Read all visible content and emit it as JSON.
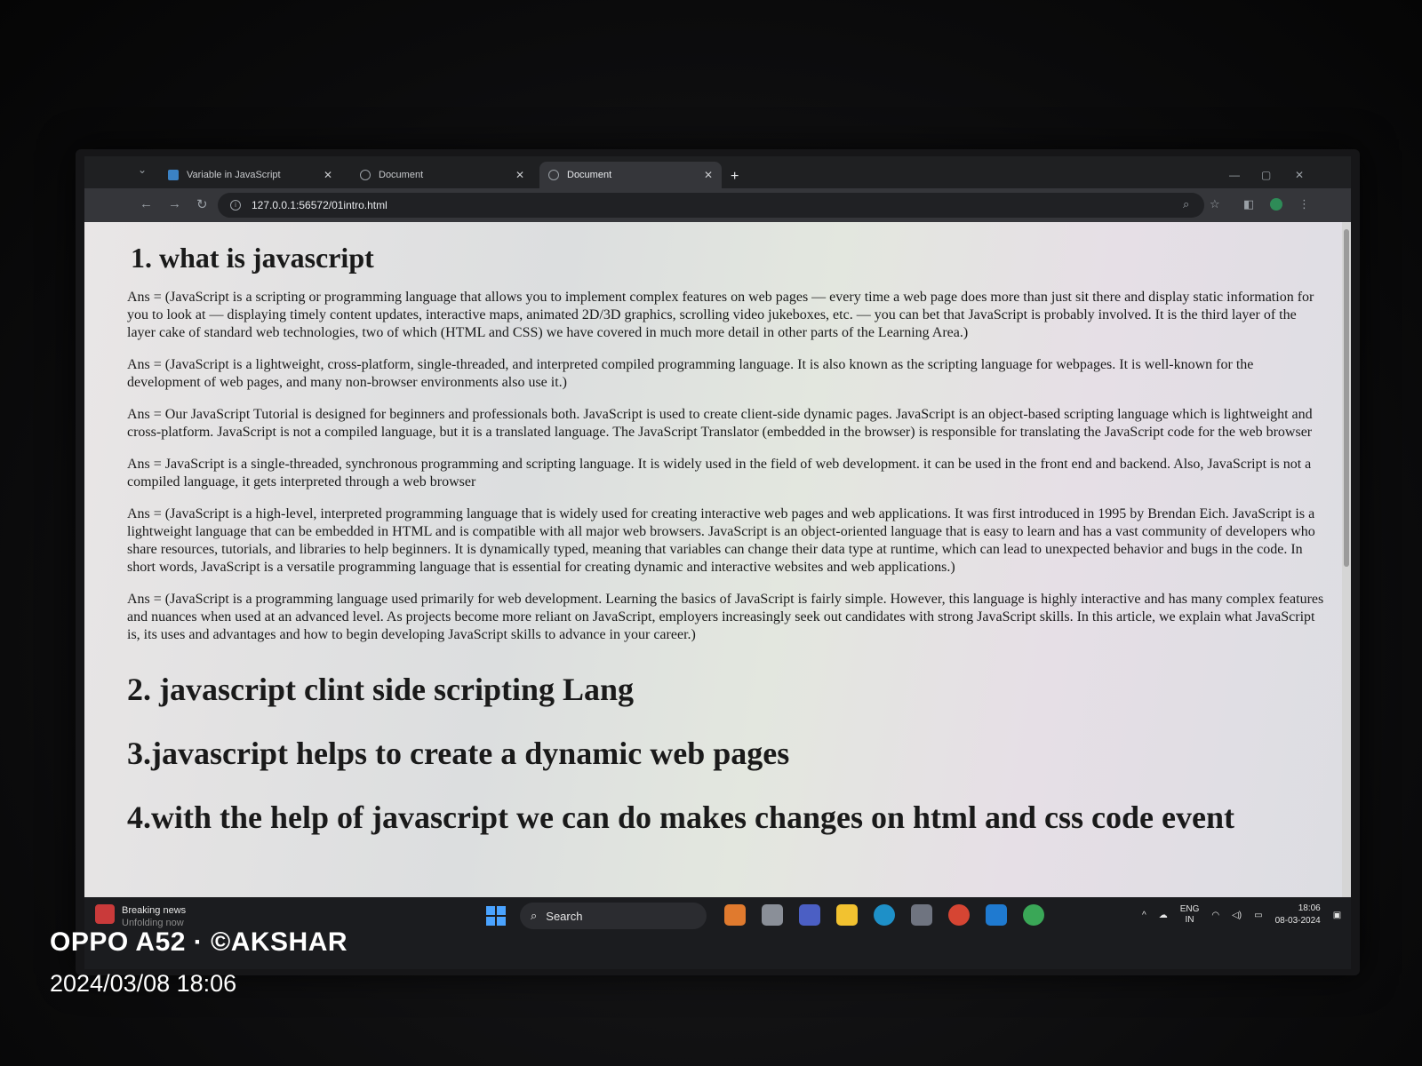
{
  "browser": {
    "tabs": [
      {
        "label": "Variable in JavaScript",
        "active": false
      },
      {
        "label": "Document",
        "active": false
      },
      {
        "label": "Document",
        "active": true
      }
    ],
    "new_tab": "+",
    "address": "127.0.0.1:56572/01intro.html"
  },
  "page": {
    "heading1": "1. what is javascript",
    "paragraphs": [
      "Ans = (JavaScript is a scripting or programming language that allows you to implement complex features on web pages — every time a web page does more than just sit there and display static information for you to look at — displaying timely content updates, interactive maps, animated 2D/3D graphics, scrolling video jukeboxes, etc. — you can bet that JavaScript is probably involved. It is the third layer of the layer cake of standard web technologies, two of which (HTML and CSS) we have covered in much more detail in other parts of the Learning Area.)",
      "Ans = (JavaScript is a lightweight, cross-platform, single-threaded, and interpreted compiled programming language. It is also known as the scripting language for webpages. It is well-known for the development of web pages, and many non-browser environments also use it.)",
      "Ans = Our JavaScript Tutorial is designed for beginners and professionals both. JavaScript is used to create client-side dynamic pages. JavaScript is an object-based scripting language which is lightweight and cross-platform. JavaScript is not a compiled language, but it is a translated language. The JavaScript Translator (embedded in the browser) is responsible for translating the JavaScript code for the web browser",
      "Ans = JavaScript is a single-threaded, synchronous programming and scripting language. It is widely used in the field of web development. it can be used in the front end and backend. Also, JavaScript is not a compiled language, it gets interpreted through a web browser",
      "Ans = (JavaScript is a high-level, interpreted programming language that is widely used for creating interactive web pages and web applications. It was first introduced in 1995 by Brendan Eich. JavaScript is a lightweight language that can be embedded in HTML and is compatible with all major web browsers. JavaScript is an object-oriented language that is easy to learn and has a vast community of developers who share resources, tutorials, and libraries to help beginners. It is dynamically typed, meaning that variables can change their data type at runtime, which can lead to unexpected behavior and bugs in the code. In short words, JavaScript is a versatile programming language that is essential for creating dynamic and interactive websites and web applications.)",
      "Ans = (JavaScript is a programming language used primarily for web development. Learning the basics of JavaScript is fairly simple. However, this language is highly interactive and has many complex features and nuances when used at an advanced level. As projects become more reliant on JavaScript, employers increasingly seek out candidates with strong JavaScript skills. In this article, we explain what JavaScript is, its uses and advantages and how to begin developing JavaScript skills to advance in your career.)"
    ],
    "heading2": "2. javascript clint side scripting Lang",
    "heading3": "3.javascript helps to create a dynamic web pages",
    "heading4": "4.with the help of javascript we can do makes changes on html and css code event"
  },
  "taskbar": {
    "news_title": "Breaking news",
    "news_sub": "Unfolding now",
    "search": "Search",
    "lang_1": "ENG",
    "lang_2": "IN",
    "time": "18:06",
    "date": "08-03-2024"
  },
  "watermark": {
    "device": "OPPO A52 · ©AKSHAR",
    "datetime": "2024/03/08 18:06"
  }
}
